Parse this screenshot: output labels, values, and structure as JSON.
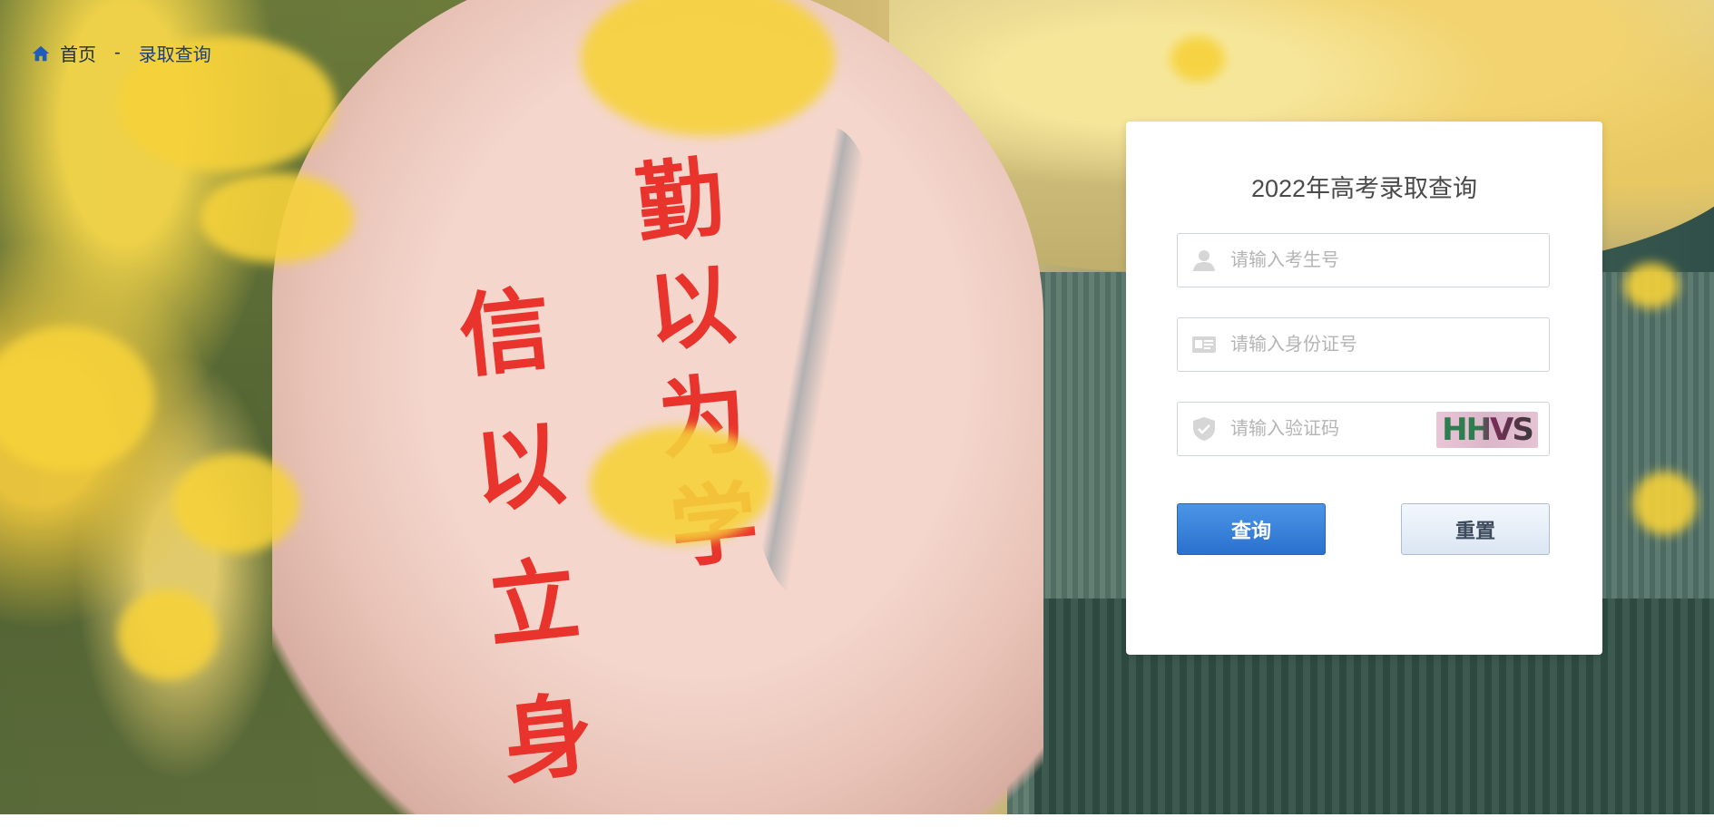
{
  "breadcrumb": {
    "home_label": "首页",
    "separator": "-",
    "current_label": "录取查询",
    "home_icon": "home-icon",
    "home_icon_color": "#1f5bb8"
  },
  "background": {
    "calligraphy_left": "信以立身",
    "calligraphy_right": "勤以为学"
  },
  "card": {
    "title": "2022年高考录取查询",
    "fields": {
      "exam_number": {
        "placeholder": "请输入考生号",
        "value": "",
        "icon": "user-icon"
      },
      "id_number": {
        "placeholder": "请输入身份证号",
        "value": "",
        "icon": "id-card-icon"
      },
      "captcha": {
        "placeholder": "请输入验证码",
        "value": "",
        "icon": "shield-icon",
        "captcha_text": "HHVS"
      }
    },
    "buttons": {
      "query_label": "查询",
      "reset_label": "重置"
    },
    "colors": {
      "query_button": "#2f7bd8",
      "reset_button": "#e4edf7"
    }
  }
}
